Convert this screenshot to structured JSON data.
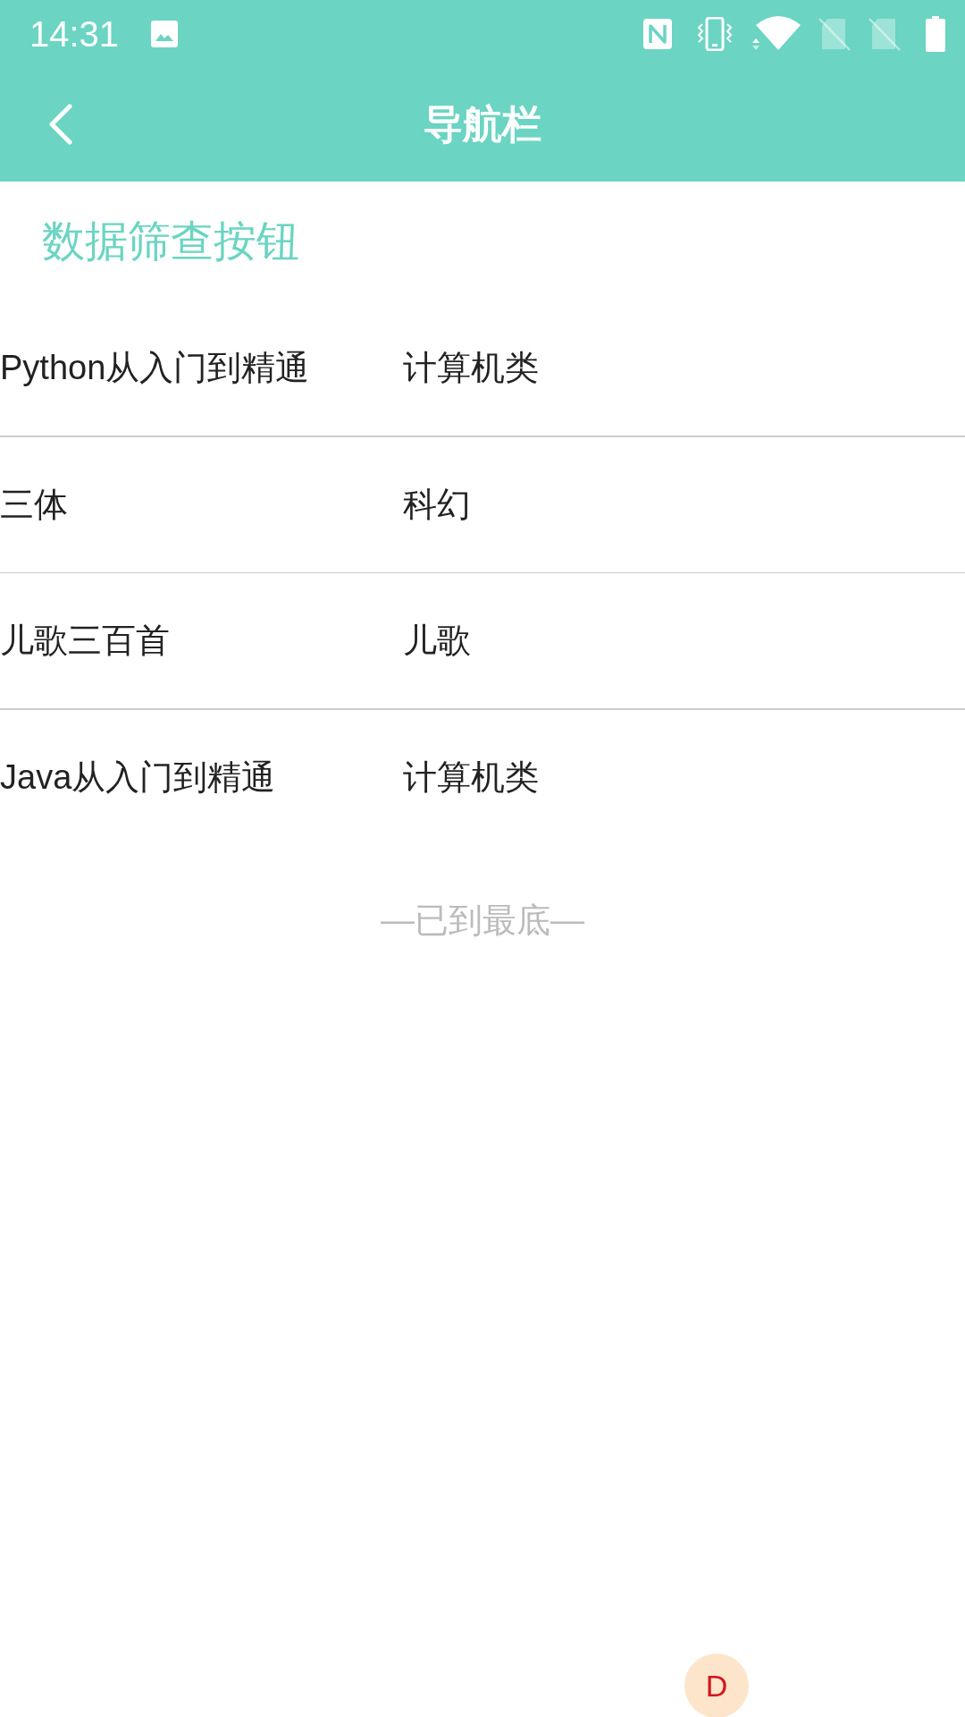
{
  "status_bar": {
    "time": "14:31"
  },
  "nav_bar": {
    "title": "导航栏"
  },
  "section_title": "数据筛查按钮",
  "rows": [
    {
      "column_1": "Python从入门到精通",
      "column_2": "计算机类"
    },
    {
      "column_1": "三体",
      "column_2": "科幻"
    },
    {
      "column_1": "儿歌三百首",
      "column_2": "儿歌"
    },
    {
      "column_1": "Java从入门到精通",
      "column_2": "计算机类"
    }
  ],
  "footer": "—已到最底—",
  "floating_badge": {
    "label": "D"
  }
}
